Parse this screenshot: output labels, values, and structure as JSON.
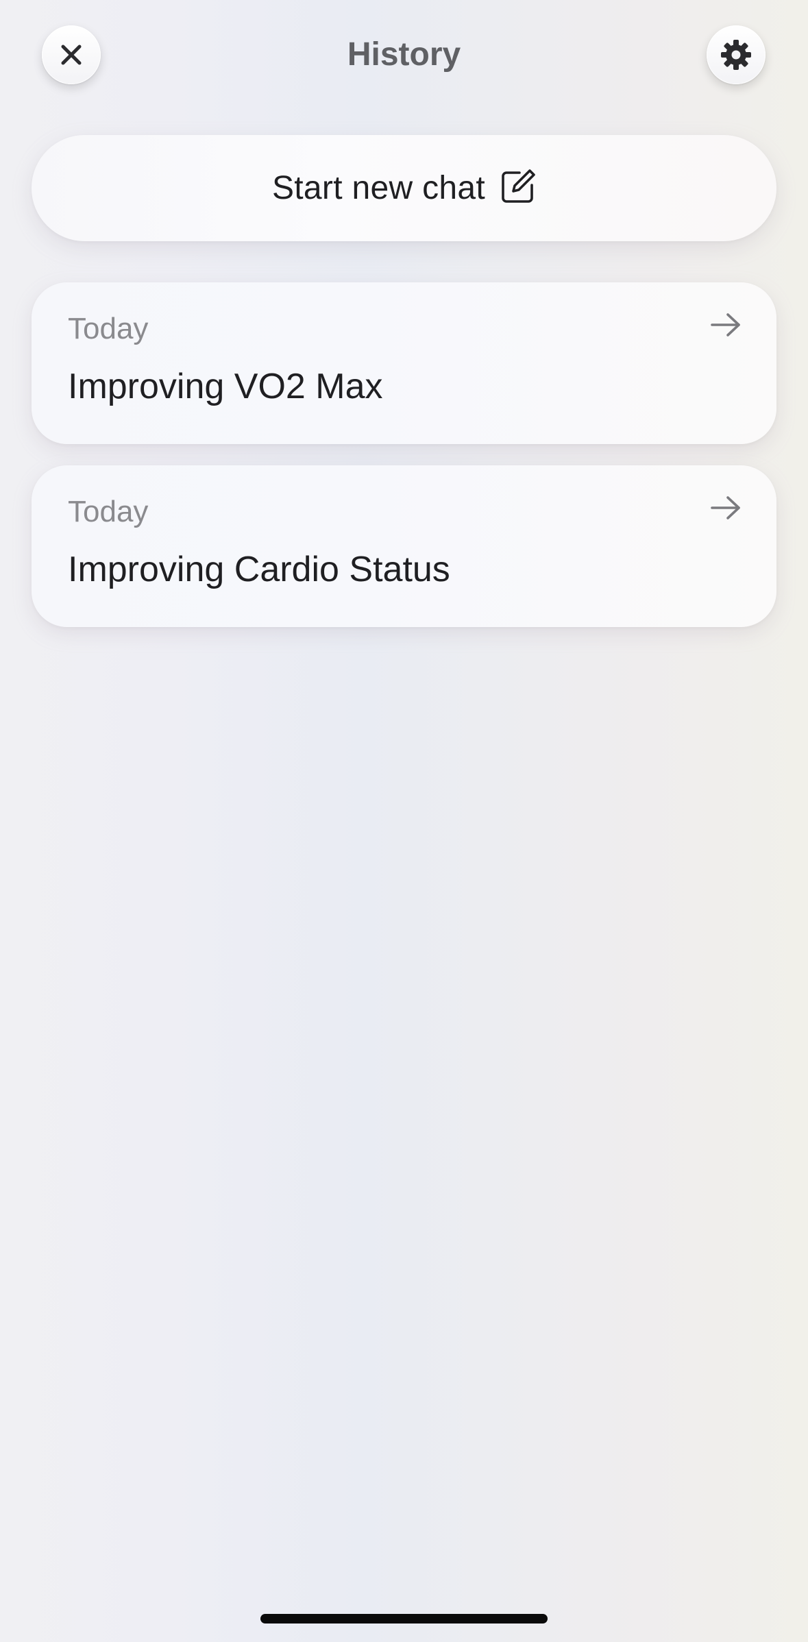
{
  "header": {
    "title": "History",
    "close_icon": "close-icon",
    "settings_icon": "gear-icon"
  },
  "new_chat": {
    "label": "Start new chat",
    "icon": "compose-icon"
  },
  "history": [
    {
      "date": "Today",
      "title": "Improving VO2 Max",
      "icon": "arrow-right-icon"
    },
    {
      "date": "Today",
      "title": "Improving Cardio Status",
      "icon": "arrow-right-icon"
    }
  ],
  "colors": {
    "title_text": "#5f6064",
    "primary_text": "#1f1f22",
    "secondary_text": "#8a8a8e",
    "home_indicator": "#0a0a0a"
  }
}
